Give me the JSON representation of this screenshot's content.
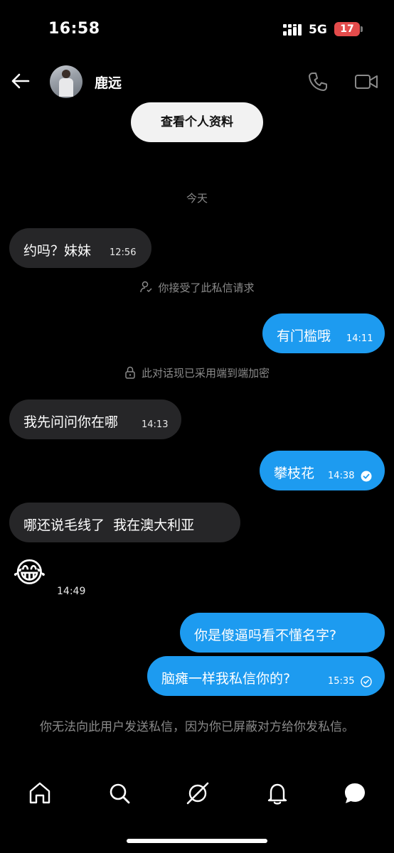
{
  "status": {
    "time": "16:58",
    "network": "5G",
    "battery": "17"
  },
  "header": {
    "contact_name": "鹿远",
    "view_profile": "查看个人资料"
  },
  "date_divider": "今天",
  "messages": [
    {
      "dir": "in",
      "text": "约吗？妹妹",
      "time": "12:56"
    },
    {
      "system": "你接受了此私信请求",
      "icon": "person-check-icon"
    },
    {
      "dir": "out",
      "text": "有门槛哦",
      "time": "14:11"
    },
    {
      "system": "此对话现已采用端到端加密",
      "icon": "lock-icon"
    },
    {
      "dir": "in",
      "text": "我先问问你在哪",
      "time": "14:13"
    },
    {
      "dir": "out",
      "text": "攀枝花",
      "time": "14:38",
      "status": "read"
    },
    {
      "dir": "in",
      "text": "哪还说毛线了  我在澳大利亚"
    },
    {
      "dir": "in",
      "emoji": "😂",
      "time": "14:49"
    },
    {
      "dir": "out",
      "text": "你是傻逼吗看不懂名字?"
    },
    {
      "dir": "out",
      "text": "脑瘫一样我私信你的?",
      "time": "15:35",
      "status": "sent"
    }
  ],
  "blocked_notice": "你无法向此用户发送私信，因为你已屏蔽对方给你发私信。",
  "nav": [
    "home-icon",
    "search-icon",
    "grok-icon",
    "bell-icon",
    "messages-icon"
  ],
  "colors": {
    "accent": "#1d9bf0",
    "incoming_bubble": "#262628",
    "background": "#000000",
    "battery": "#e44b4b"
  }
}
